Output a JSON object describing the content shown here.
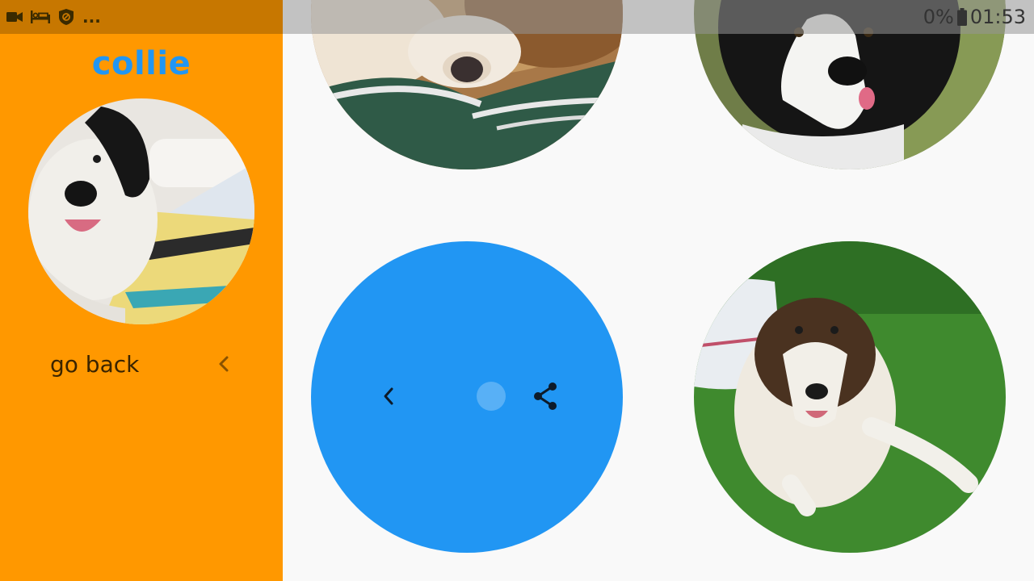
{
  "status_bar": {
    "overflow_indicator": "...",
    "battery_text": "0%",
    "time": "01:53",
    "left_icons": [
      "video-camera-icon",
      "bed-icon",
      "shield-icon"
    ],
    "right_icons": [
      "battery-icon"
    ]
  },
  "drawer": {
    "title": "collie",
    "title_color": "#2196f3",
    "background_color": "#ff9800",
    "go_back_label": "go back",
    "avatar": "collie-photo"
  },
  "grid": {
    "photos": [
      "rough-collie-photo",
      "border-collie-photo",
      "collie-on-grass-photo"
    ],
    "menu": {
      "color": "#2196f3",
      "icons": [
        "back-chevron-icon",
        "share-icon"
      ]
    }
  }
}
